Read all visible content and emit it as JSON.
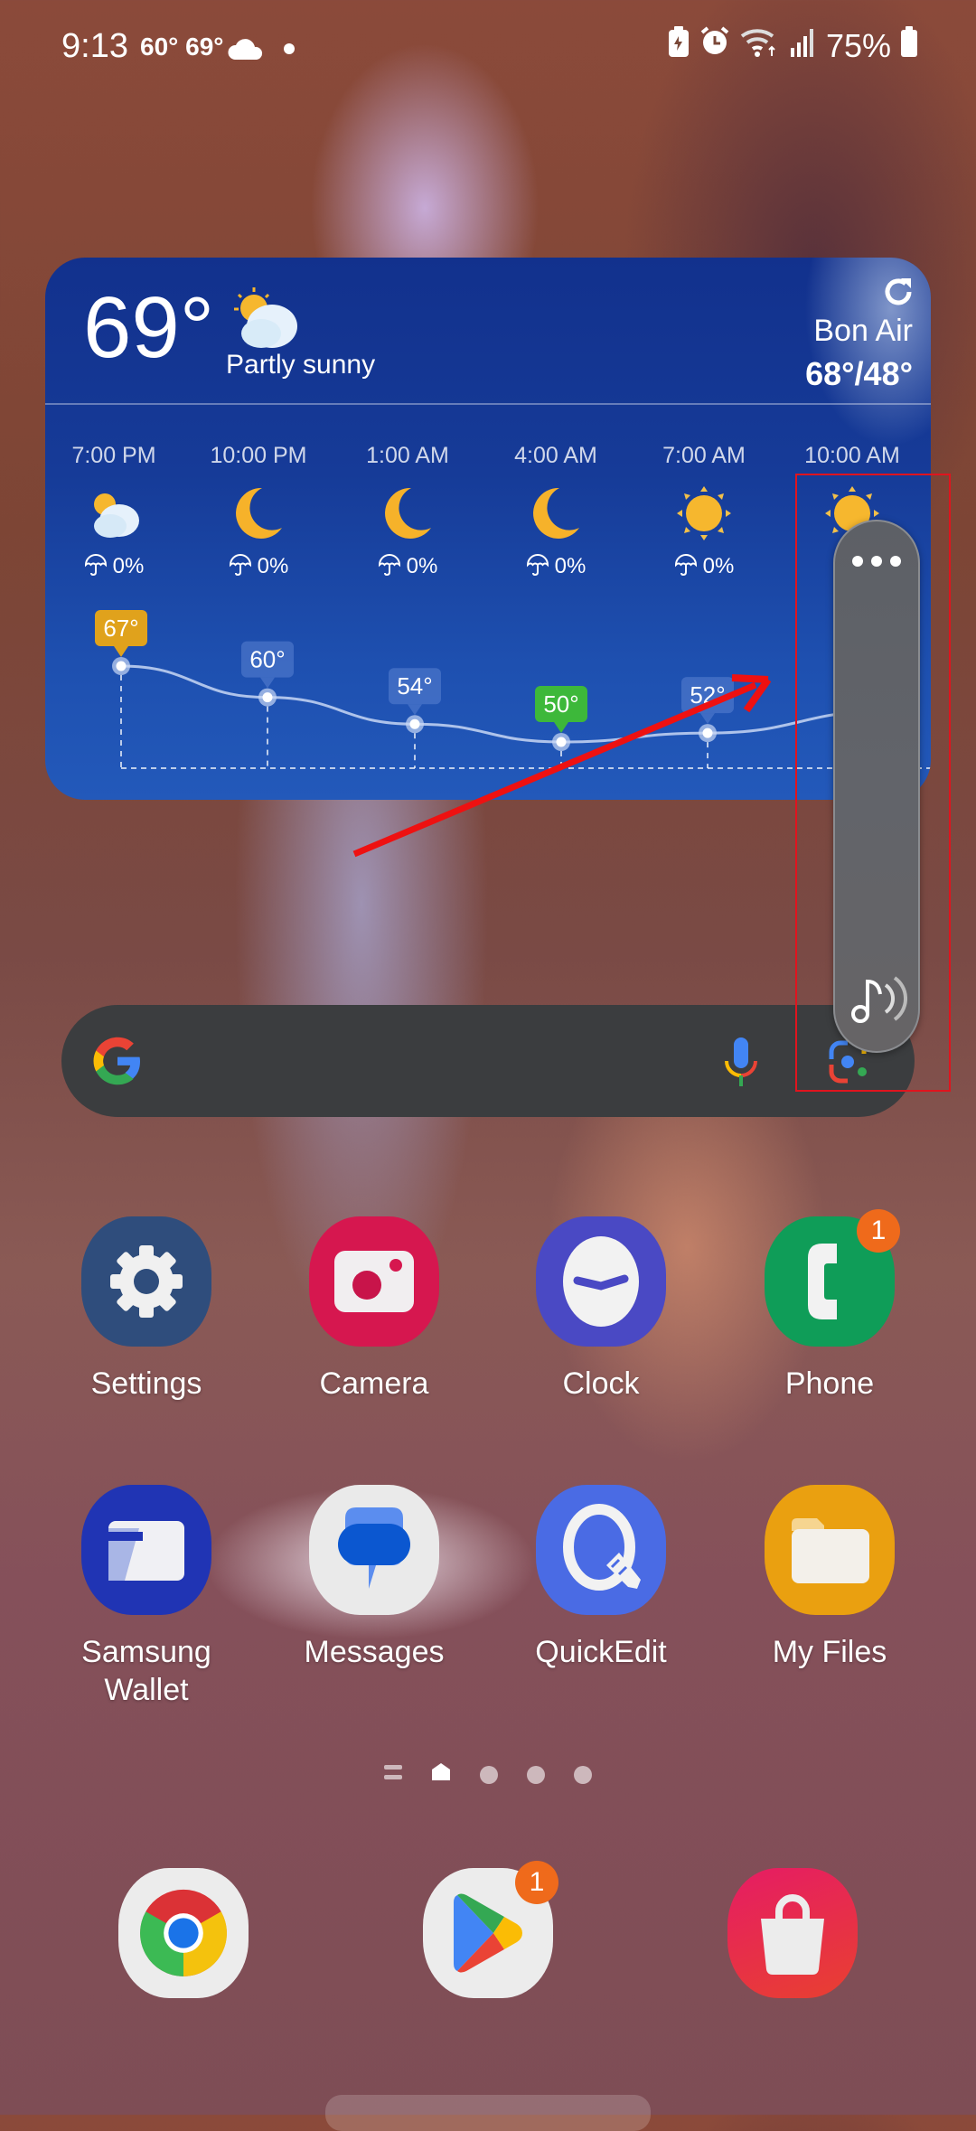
{
  "status_bar": {
    "time": "9:13",
    "temps": "60° 69°",
    "weather_icon": "cloud-icon",
    "battery_percent": "75%",
    "icons": [
      "battery-saver-icon",
      "alarm-icon",
      "wifi-icon",
      "signal-icon",
      "battery-icon"
    ]
  },
  "weather_widget": {
    "current_temp": "69°",
    "condition": "Partly sunny",
    "condition_icon": "partly-sunny-icon",
    "location": "Bon Air",
    "high_low": "68°/48°",
    "refresh_icon": "refresh-icon",
    "hourly": [
      {
        "time": "7:00 PM",
        "icon": "partly-sunny-icon",
        "precip": "0%",
        "temp": "67°",
        "highlight": "high"
      },
      {
        "time": "10:00 PM",
        "icon": "moon-icon",
        "precip": "0%",
        "temp": "60°",
        "highlight": "none"
      },
      {
        "time": "1:00 AM",
        "icon": "moon-icon",
        "precip": "0%",
        "temp": "54°",
        "highlight": "none"
      },
      {
        "time": "4:00 AM",
        "icon": "moon-icon",
        "precip": "0%",
        "temp": "50°",
        "highlight": "low"
      },
      {
        "time": "7:00 AM",
        "icon": "sun-icon",
        "precip": "0%",
        "temp": "52°",
        "highlight": "none"
      },
      {
        "time": "10:00 AM",
        "icon": "sun-icon",
        "precip": "",
        "temp": "",
        "highlight": "none"
      }
    ],
    "colors": {
      "high_tag": "#e0a21c",
      "low_tag": "#3db83a",
      "card": "#163b98"
    }
  },
  "search_bar": {
    "google_icon": "google-g-icon",
    "mic_icon": "microphone-icon",
    "lens_icon": "google-lens-icon"
  },
  "floating_panel": {
    "more_icon": "more-dots-icon",
    "music_icon": "music-recognition-icon"
  },
  "apps_row1": [
    {
      "label": "Settings",
      "icon": "settings-gear-icon",
      "color": "#2f4d7c",
      "badge": ""
    },
    {
      "label": "Camera",
      "icon": "camera-icon",
      "color": "#d6174f",
      "badge": ""
    },
    {
      "label": "Clock",
      "icon": "clock-icon",
      "color": "#4a49c4",
      "badge": ""
    },
    {
      "label": "Phone",
      "icon": "phone-icon",
      "color": "#0f9d58",
      "badge": "1"
    }
  ],
  "apps_row2": [
    {
      "label": "Samsung\nWallet",
      "label_line1": "Samsung",
      "label_line2": "Wallet",
      "icon": "wallet-icon",
      "color": "#2034b4",
      "badge": ""
    },
    {
      "label": "Messages",
      "icon": "messages-icon",
      "color": "#eaeaea",
      "badge": ""
    },
    {
      "label": "QuickEdit",
      "icon": "quickedit-icon",
      "color": "#4a6be4",
      "badge": ""
    },
    {
      "label": "My Files",
      "icon": "folder-icon",
      "color": "#eaa010",
      "badge": ""
    }
  ],
  "page_indicator": {
    "pages": 4,
    "current": "home"
  },
  "dock": [
    {
      "name": "Chrome",
      "icon": "chrome-icon",
      "badge": ""
    },
    {
      "name": "Play Store",
      "icon": "play-store-icon",
      "badge": "1"
    },
    {
      "name": "Galaxy Store",
      "icon": "galaxy-store-icon",
      "badge": ""
    }
  ],
  "annotation": {
    "arrow_color": "#ee1111",
    "frame_color": "#e0141e"
  }
}
